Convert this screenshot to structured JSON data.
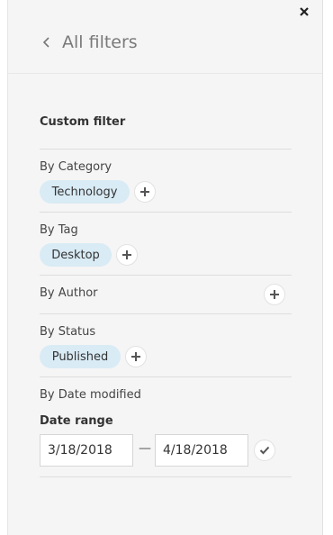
{
  "header": {
    "back_label": "All filters"
  },
  "filter": {
    "title": "Custom filter",
    "category": {
      "label": "By Category",
      "chip": "Technology"
    },
    "tag": {
      "label": "By Tag",
      "chip": "Desktop"
    },
    "author": {
      "label": "By Author"
    },
    "status": {
      "label": "By Status",
      "chip": "Published"
    },
    "date": {
      "label": "By Date modified",
      "range_title": "Date range",
      "from": "3/18/2018",
      "to": "4/18/2018",
      "separator": "—"
    }
  },
  "icons": {
    "close": "close-icon",
    "back": "chevron-left-icon",
    "add": "plus-icon",
    "apply": "check-icon"
  },
  "colors": {
    "panel_bg": "#f5f5f5",
    "chip_bg": "#d9ebf5"
  }
}
